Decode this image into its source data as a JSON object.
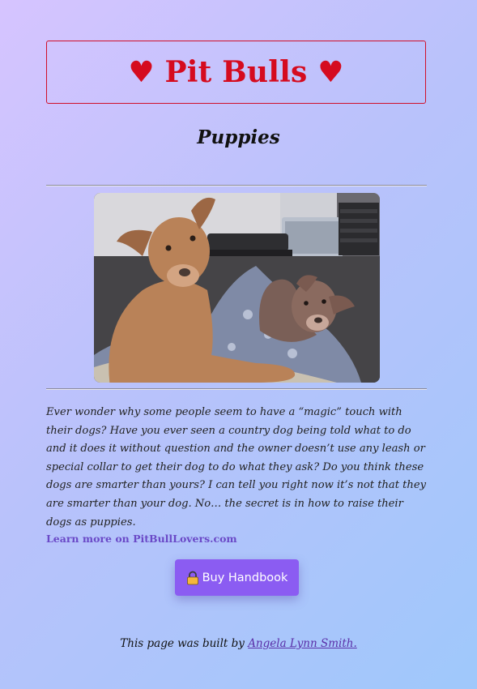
{
  "header": {
    "title": "♥ Pit Bulls ♥",
    "subtitle": "Puppies"
  },
  "hero_image": {
    "alt": "Two pit bull puppies on a blanket"
  },
  "article": {
    "body": "Ever wonder why some people seem to have a “magic” touch with their dogs? Have you ever seen a country dog being told what to do and it does it without question and the owner doesn’t use any leash or special collar to get their dog to do what they ask? Do you think these dogs are smarter than yours? I can tell you right now it’s not that they are smarter than your dog. No… the secret is in how to raise their dogs as puppies."
  },
  "links": {
    "learn_more": "Learn more on PitBullLovers.com"
  },
  "cta": {
    "icon": "lock-icon",
    "label": "Buy Handbook"
  },
  "footer": {
    "prefix": "This page was built by ",
    "author": "Angela Lynn Smith."
  },
  "colors": {
    "title_red": "#d50b1f",
    "button_purple": "#8b5cf2",
    "link_purple": "#6a49c7"
  }
}
